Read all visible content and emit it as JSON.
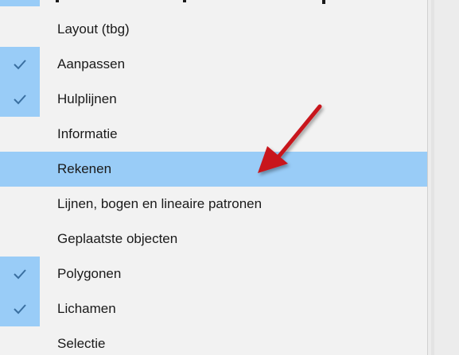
{
  "menu": {
    "items": [
      {
        "label": "Layout (tbg)",
        "checked": false,
        "highlighted": false
      },
      {
        "label": "Aanpassen",
        "checked": true,
        "highlighted": false
      },
      {
        "label": "Hulplijnen",
        "checked": true,
        "highlighted": false
      },
      {
        "label": "Informatie",
        "checked": false,
        "highlighted": false
      },
      {
        "label": "Rekenen",
        "checked": false,
        "highlighted": true
      },
      {
        "label": "Lijnen, bogen en lineaire patronen",
        "checked": false,
        "highlighted": false
      },
      {
        "label": "Geplaatste objecten",
        "checked": false,
        "highlighted": false
      },
      {
        "label": "Polygonen",
        "checked": true,
        "highlighted": false
      },
      {
        "label": "Lichamen",
        "checked": true,
        "highlighted": false
      },
      {
        "label": "Selectie",
        "checked": false,
        "highlighted": false
      }
    ]
  },
  "colors": {
    "menu_background": "#f2f2f2",
    "highlight": "#99ccf7",
    "check_column": "#99ccf7",
    "checkmark": "#3a6fa0",
    "text": "#1a1a1a",
    "arrow": "#c8161d"
  },
  "icons": {
    "check": "checkmark-icon",
    "annotation": "red-arrow-icon"
  }
}
